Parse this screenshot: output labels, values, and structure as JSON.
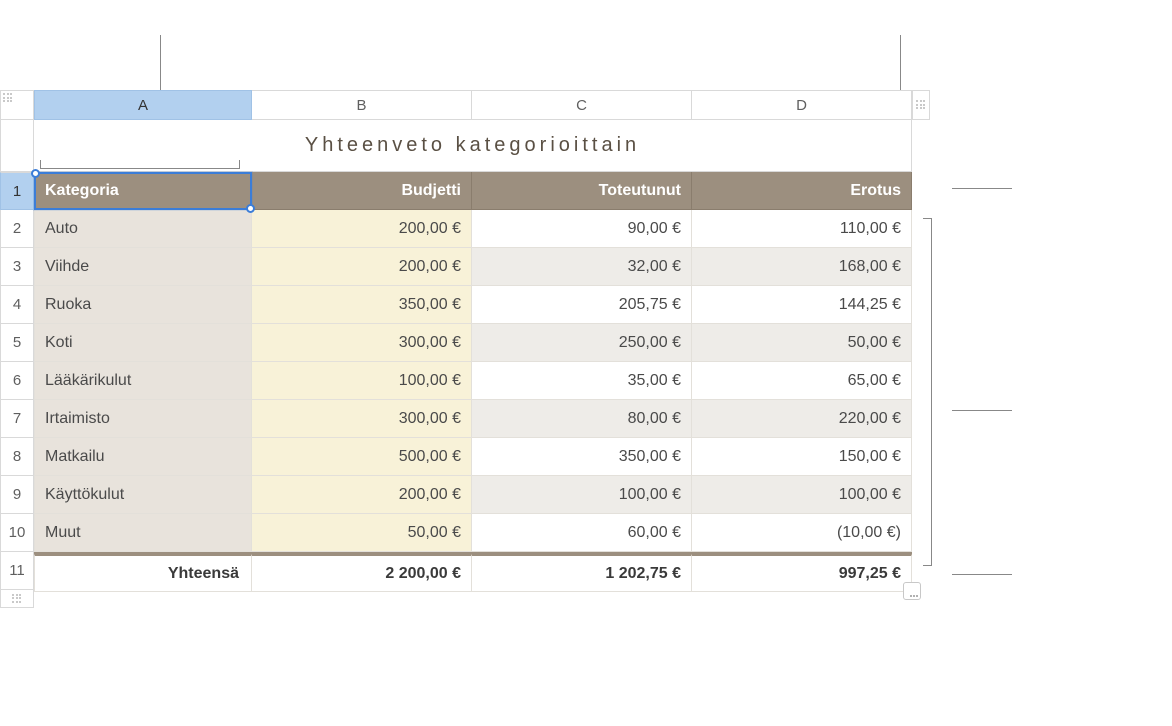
{
  "columns": {
    "A": "A",
    "B": "B",
    "C": "C",
    "D": "D"
  },
  "rowLabels": [
    "1",
    "2",
    "3",
    "4",
    "5",
    "6",
    "7",
    "8",
    "9",
    "10",
    "11"
  ],
  "title": "Yhteenveto kategorioittain",
  "headers": {
    "category": "Kategoria",
    "budget": "Budjetti",
    "actual": "Toteutunut",
    "diff": "Erotus"
  },
  "rows": [
    {
      "category": "Auto",
      "budget": "200,00 €",
      "actual": "90,00 €",
      "diff": "110,00 €"
    },
    {
      "category": "Viihde",
      "budget": "200,00 €",
      "actual": "32,00 €",
      "diff": "168,00 €"
    },
    {
      "category": "Ruoka",
      "budget": "350,00 €",
      "actual": "205,75 €",
      "diff": "144,25 €"
    },
    {
      "category": "Koti",
      "budget": "300,00 €",
      "actual": "250,00 €",
      "diff": "50,00 €"
    },
    {
      "category": "Lääkärikulut",
      "budget": "100,00 €",
      "actual": "35,00 €",
      "diff": "65,00 €"
    },
    {
      "category": "Irtaimisto",
      "budget": "300,00 €",
      "actual": "80,00 €",
      "diff": "220,00 €"
    },
    {
      "category": "Matkailu",
      "budget": "500,00 €",
      "actual": "350,00 €",
      "diff": "150,00 €"
    },
    {
      "category": "Käyttökulut",
      "budget": "200,00 €",
      "actual": "100,00 €",
      "diff": "100,00 €"
    },
    {
      "category": "Muut",
      "budget": "50,00 €",
      "actual": "60,00 €",
      "diff": "(10,00 €)",
      "diffNeg": true
    }
  ],
  "total": {
    "label": "Yhteensä",
    "budget": "2 200,00 €",
    "actual": "1 202,75 €",
    "diff": "997,25 €"
  },
  "chart_data": {
    "type": "table",
    "title": "Yhteenveto kategorioittain",
    "columns": [
      "Kategoria",
      "Budjetti",
      "Toteutunut",
      "Erotus"
    ],
    "categories": [
      "Auto",
      "Viihde",
      "Ruoka",
      "Koti",
      "Lääkärikulut",
      "Irtaimisto",
      "Matkailu",
      "Käyttökulut",
      "Muut"
    ],
    "series": [
      {
        "name": "Budjetti",
        "values": [
          200.0,
          200.0,
          350.0,
          300.0,
          100.0,
          300.0,
          500.0,
          200.0,
          50.0
        ]
      },
      {
        "name": "Toteutunut",
        "values": [
          90.0,
          32.0,
          205.75,
          250.0,
          35.0,
          80.0,
          350.0,
          100.0,
          60.0
        ]
      },
      {
        "name": "Erotus",
        "values": [
          110.0,
          168.0,
          144.25,
          50.0,
          65.0,
          220.0,
          150.0,
          100.0,
          -10.0
        ]
      }
    ],
    "totals": {
      "Budjetti": 2200.0,
      "Toteutunut": 1202.75,
      "Erotus": 997.25
    },
    "currency": "EUR"
  }
}
